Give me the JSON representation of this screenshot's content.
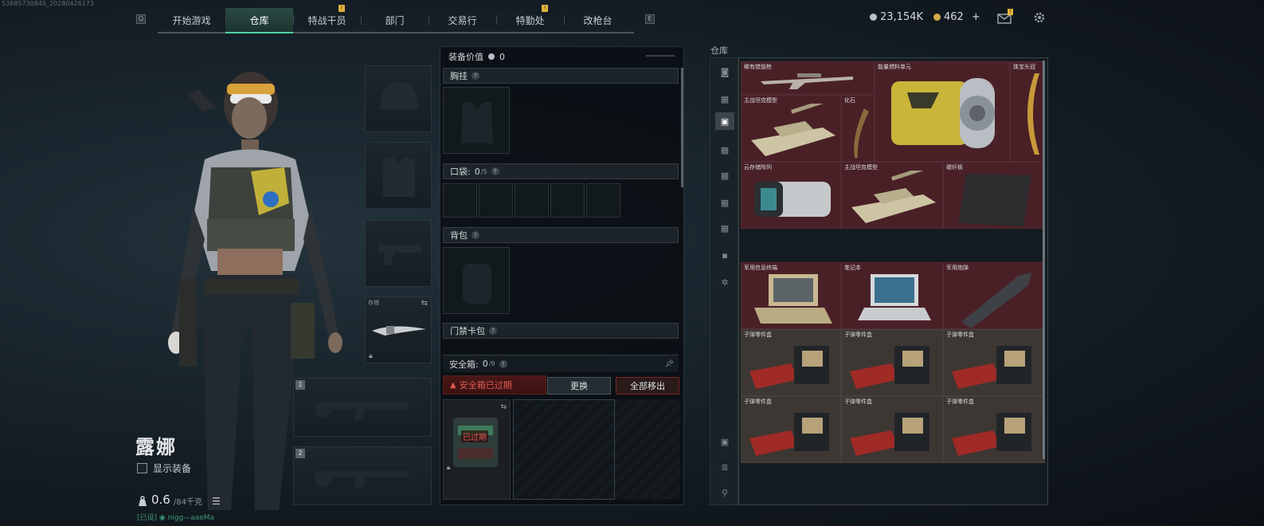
{
  "debug": {
    "id": "5388573084S_20280426173"
  },
  "nav": {
    "tabs": [
      {
        "label": "开始游戏",
        "active": false,
        "badge": false
      },
      {
        "label": "仓库",
        "active": true,
        "badge": false
      },
      {
        "label": "特战干员",
        "active": false,
        "badge": true
      },
      {
        "label": "部门",
        "active": false,
        "badge": false
      },
      {
        "label": "交易行",
        "active": false,
        "badge": false
      },
      {
        "label": "特勤处",
        "active": false,
        "badge": true
      },
      {
        "label": "改枪台",
        "active": false,
        "badge": false
      }
    ],
    "left_key": "Q",
    "right_key": "E"
  },
  "currency": {
    "coins": "23,154K",
    "premium": "462",
    "add_label": "+"
  },
  "character": {
    "name": "露娜",
    "show_equipment_label": "显示装备",
    "weight_value": "0.6",
    "weight_capacity": "/84千克",
    "bottom_info": "[已设] ◉ nigg—aaeMa"
  },
  "slots": {
    "melee_label": "存储",
    "weapon1_number": "1",
    "weapon2_number": "2"
  },
  "equipment": {
    "value_label": "装备价值",
    "value": "0",
    "chest_rig_label": "胸挂",
    "pockets_label": "口袋:",
    "pockets_used": "0",
    "pockets_total": "/5",
    "backpack_label": "背包",
    "keycard_label": "门禁卡包",
    "safe_box_label": "安全箱:",
    "safe_box_used": "0",
    "safe_box_total": "/9",
    "expired_notice": "安全箱已过期",
    "replace_button": "更换",
    "remove_all_button": "全部移出",
    "safe_box_item_label": "已过期"
  },
  "warehouse": {
    "title": "仓库",
    "sidebar_icons": [
      "all-icon",
      "sort-1-icon",
      "sort-2-icon",
      "sort-3-icon",
      "sort-4-icon",
      "sort-5-icon",
      "sort-6-icon",
      "lock-icon",
      "gear-icon",
      "device-icon",
      "layers-icon",
      "clean-icon"
    ],
    "items": [
      {
        "name": "稀有猎狙枪",
        "color": "red"
      },
      {
        "name": "能量燃料单元",
        "color": "red"
      },
      {
        "name": "珠宝头冠",
        "color": "red"
      },
      {
        "name": "主战坦克模型",
        "color": "red"
      },
      {
        "name": "化石",
        "color": "red"
      },
      {
        "name": "主战坦克模型",
        "color": "red"
      },
      {
        "name": "碳纤板",
        "color": "red"
      },
      {
        "name": "云存储阵列",
        "color": "red"
      },
      {
        "name": "军用信息终端",
        "color": "red"
      },
      {
        "name": "笔记本",
        "color": "red"
      },
      {
        "name": "军用炮弹",
        "color": "red"
      },
      {
        "name": "子弹零件盒",
        "color": "grey"
      },
      {
        "name": "子弹零件盒",
        "color": "grey"
      },
      {
        "name": "子弹零件盒",
        "color": "grey"
      },
      {
        "name": "子弹零件盒",
        "color": "grey"
      },
      {
        "name": "子弹零件盒",
        "color": "grey"
      },
      {
        "name": "子弹零件盒",
        "color": "grey"
      }
    ]
  },
  "colors": {
    "accent": "#4fd1a4",
    "rarity_red": "#4a2027",
    "rarity_grey": "#3d3733",
    "warning": "#e05a52"
  }
}
